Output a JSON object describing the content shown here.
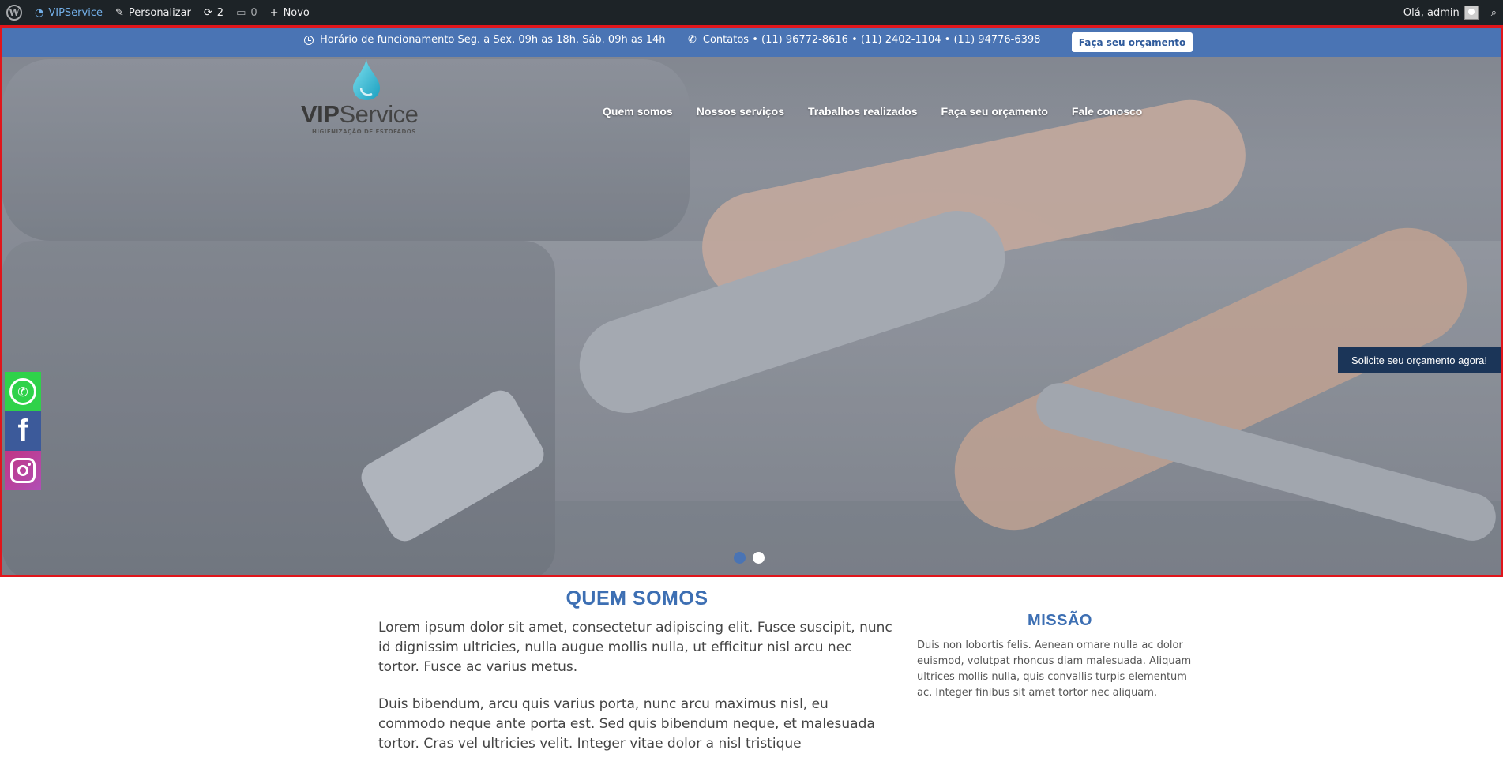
{
  "adminbar": {
    "site_name": "VIPService",
    "customize": "Personalizar",
    "updates_count": "2",
    "comments_count": "0",
    "new_label": "Novo",
    "greeting": "Olá, admin"
  },
  "topbar": {
    "hours": "Horário de funcionamento Seg. a Sex. 09h as 18h. Sáb. 09h as 14h",
    "contacts": "Contatos • (11) 96772-8616 • (11) 2402-1104 • (11) 94776-6398",
    "quote_button": "Faça seu orçamento"
  },
  "logo": {
    "brand_bold": "VIP",
    "brand_light": "Service",
    "tagline": "HIGIENIZAÇÃO DE ESTOFADOS"
  },
  "nav": {
    "items": [
      "Quem somos",
      "Nossos serviços",
      "Trabalhos realizados",
      "Faça seu orçamento",
      "Fale conosco"
    ]
  },
  "hero": {
    "cta": "Solicite seu orçamento agora!",
    "slides_total": 2,
    "active_slide": 1
  },
  "about": {
    "title": "QUEM SOMOS",
    "paragraphs": [
      "Lorem ipsum dolor sit amet, consectetur adipiscing elit. Fusce suscipit, nunc id dignissim ultricies, nulla augue mollis nulla, ut efficitur nisl arcu nec tortor. Fusce ac varius metus.",
      "Duis bibendum, arcu quis varius porta, nunc arcu maximus nisl, eu commodo neque ante porta est. Sed quis bibendum neque, et malesuada tortor. Cras vel ultricies velit. Integer vitae dolor a nisl tristique"
    ]
  },
  "mission": {
    "title": "MISSÃO",
    "text": "Duis non lobortis felis. Aenean ornare nulla ac dolor euismod, volutpat rhoncus diam malesuada. Aliquam ultrices mollis nulla, quis convallis turpis elementum ac. Integer finibus sit amet tortor nec aliquam."
  },
  "colors": {
    "brand_blue": "#4a74b4",
    "cta_dark": "#1b3558",
    "whatsapp": "#2fd24a",
    "facebook": "#3c5a9a",
    "instagram": "#c13584",
    "hero_border": "#e0151b"
  }
}
